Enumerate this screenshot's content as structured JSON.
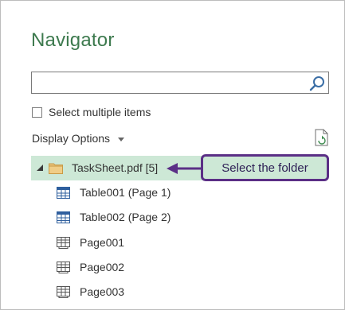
{
  "navigator": {
    "title": "Navigator",
    "search": {
      "value": "",
      "placeholder": ""
    },
    "select_multiple": {
      "label": "Select multiple items",
      "checked": false
    },
    "display_options": {
      "label": "Display Options"
    }
  },
  "tree": {
    "root": {
      "label": "TaskSheet.pdf [5]",
      "expanded": true,
      "selected": true
    },
    "items": [
      {
        "label": "Table001 (Page 1)",
        "icon": "table-icon"
      },
      {
        "label": "Table002 (Page 2)",
        "icon": "table-icon"
      },
      {
        "label": "Page001",
        "icon": "page-icon"
      },
      {
        "label": "Page002",
        "icon": "page-icon"
      },
      {
        "label": "Page003",
        "icon": "page-icon"
      }
    ]
  },
  "callout": {
    "text": "Select the folder"
  },
  "colors": {
    "title": "#3d7a4e",
    "selection": "#cde8d6",
    "callout_border": "#5b2f86",
    "folder": "#e8c27a"
  }
}
